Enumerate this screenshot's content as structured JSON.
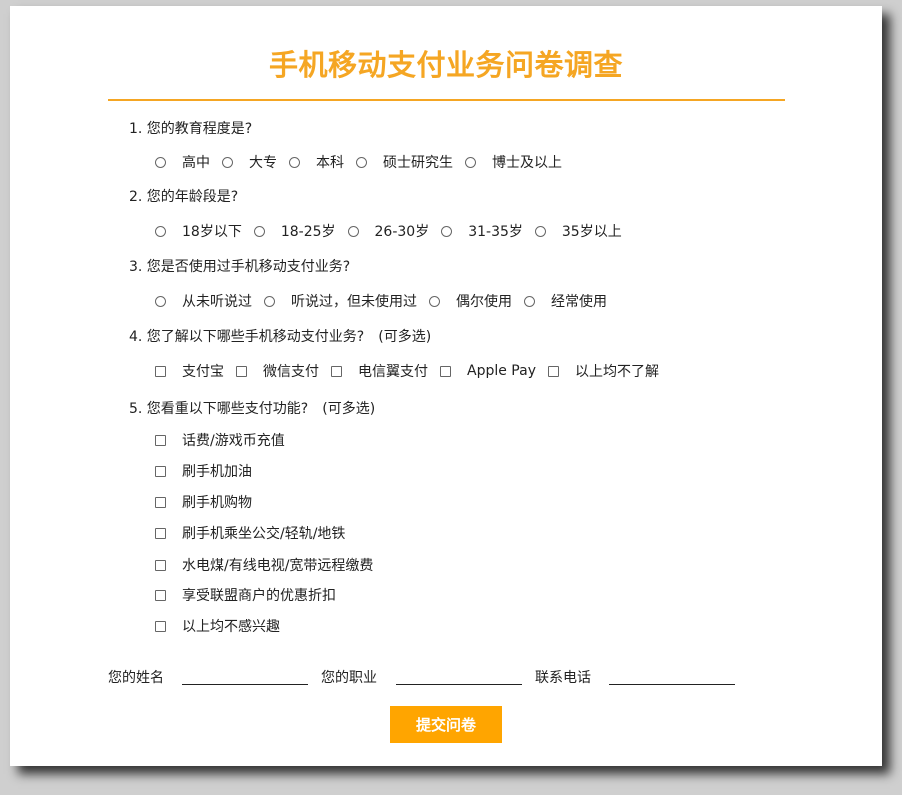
{
  "title": "手机移动支付业务问卷调查",
  "q1": {
    "text": "1. 您的教育程度是?",
    "options": [
      "高中",
      "大专",
      "本科",
      "硕士研究生",
      "博士及以上"
    ]
  },
  "q2": {
    "text": "2. 您的年龄段是?",
    "options": [
      "18岁以下",
      "18-25岁",
      "26-30岁",
      "31-35岁",
      "35岁以上"
    ]
  },
  "q3": {
    "text": "3. 您是否使用过手机移动支付业务?",
    "options": [
      "从未听说过",
      "听说过，但未使用过",
      "偶尔使用",
      "经常使用"
    ]
  },
  "q4": {
    "text": "4. 您了解以下哪些手机移动支付业务?　(可多选)",
    "options": [
      "支付宝",
      "微信支付",
      "电信翼支付",
      "Apple Pay",
      "以上均不了解"
    ]
  },
  "q5": {
    "text": "5. 您看重以下哪些支付功能?　(可多选)",
    "options": [
      "话费/游戏币充值",
      "刷手机加油",
      "刷手机购物",
      "刷手机乘坐公交/轻轨/地铁",
      "水电煤/有线电视/宽带远程缴费",
      "享受联盟商户的优惠折扣",
      "以上均不感兴趣"
    ]
  },
  "fields": {
    "name_label": "您的姓名",
    "job_label": "您的职业",
    "phone_label": "联系电话"
  },
  "submit_label": "提交问卷",
  "colors": {
    "accent": "#f5a623",
    "button": "#ffa500"
  }
}
